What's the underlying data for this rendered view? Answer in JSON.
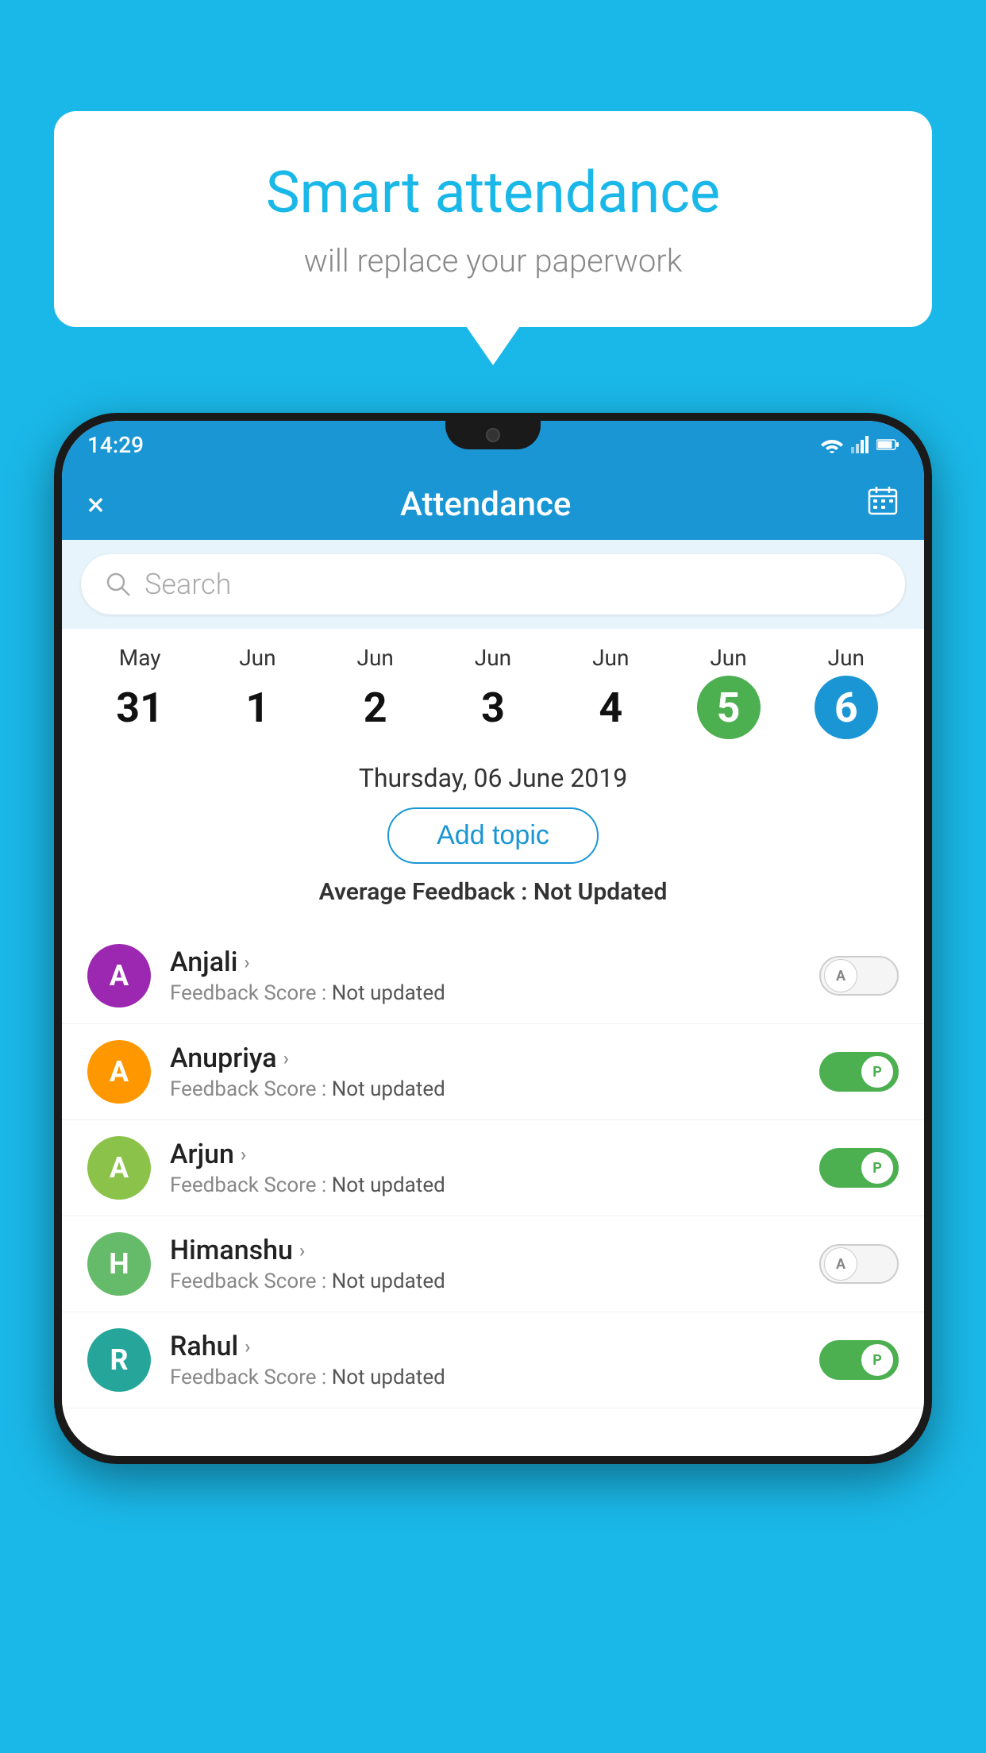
{
  "background_color": "#1ab8e8",
  "speech_bubble": {
    "title": "Smart attendance",
    "subtitle": "will replace your paperwork"
  },
  "phone": {
    "status_bar": {
      "time": "14:29"
    },
    "app_bar": {
      "title": "Attendance",
      "close_label": "×",
      "calendar_label": "📅"
    },
    "search": {
      "placeholder": "Search"
    },
    "calendar": {
      "days": [
        {
          "month": "May",
          "date": "31",
          "style": "normal"
        },
        {
          "month": "Jun",
          "date": "1",
          "style": "normal"
        },
        {
          "month": "Jun",
          "date": "2",
          "style": "normal"
        },
        {
          "month": "Jun",
          "date": "3",
          "style": "normal"
        },
        {
          "month": "Jun",
          "date": "4",
          "style": "normal"
        },
        {
          "month": "Jun",
          "date": "5",
          "style": "today"
        },
        {
          "month": "Jun",
          "date": "6",
          "style": "selected"
        }
      ]
    },
    "selected_date": "Thursday, 06 June 2019",
    "add_topic_label": "Add topic",
    "average_feedback_label": "Average Feedback :",
    "average_feedback_value": "Not Updated",
    "students": [
      {
        "name": "Anjali",
        "initial": "A",
        "avatar_color": "purple",
        "feedback_label": "Feedback Score :",
        "feedback_value": "Not updated",
        "toggle_state": "off",
        "toggle_letter": "A"
      },
      {
        "name": "Anupriya",
        "initial": "A",
        "avatar_color": "orange",
        "feedback_label": "Feedback Score :",
        "feedback_value": "Not updated",
        "toggle_state": "on",
        "toggle_letter": "P"
      },
      {
        "name": "Arjun",
        "initial": "A",
        "avatar_color": "green",
        "feedback_label": "Feedback Score :",
        "feedback_value": "Not updated",
        "toggle_state": "on",
        "toggle_letter": "P"
      },
      {
        "name": "Himanshu",
        "initial": "H",
        "avatar_color": "light-green",
        "feedback_label": "Feedback Score :",
        "feedback_value": "Not updated",
        "toggle_state": "off",
        "toggle_letter": "A"
      },
      {
        "name": "Rahul",
        "initial": "R",
        "avatar_color": "teal",
        "feedback_label": "Feedback Score :",
        "feedback_value": "Not updated",
        "toggle_state": "on",
        "toggle_letter": "P"
      }
    ]
  }
}
